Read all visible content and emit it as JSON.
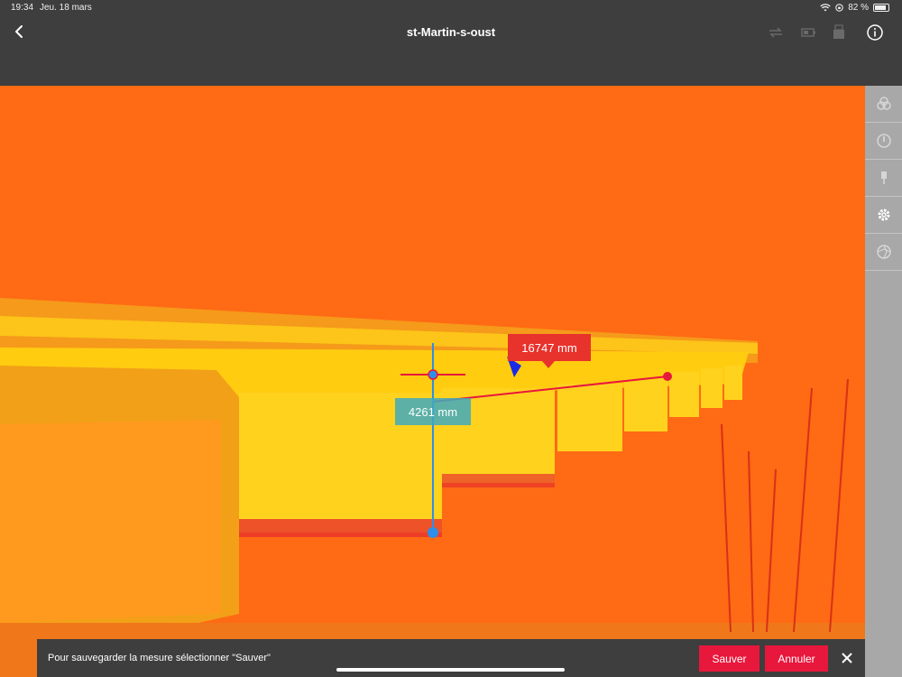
{
  "status": {
    "time": "19:34",
    "date": "Jeu. 18 mars",
    "battery": "82 %"
  },
  "header": {
    "title": "st-Martin-s-oust"
  },
  "measurements": {
    "horizontal": "16747  mm",
    "vertical": "4261  mm"
  },
  "footer": {
    "hint": "Pour sauvegarder la mesure sélectionner \"Sauver\"",
    "save_label": "Sauver",
    "cancel_label": "Annuler"
  },
  "icons": {
    "back": "back-chevron-icon",
    "swap": "swap-icon",
    "battery": "scanner-battery-icon",
    "storage": "storage-icon",
    "info": "info-icon",
    "tools": [
      "layers-icon",
      "compass-icon",
      "probe-icon",
      "gear-icon",
      "aperture-icon"
    ]
  },
  "colors": {
    "bar": "#3e3e3e",
    "accent": "#e8173c",
    "scene": "#ff6a14",
    "toolbar": "#a8a8a8"
  }
}
